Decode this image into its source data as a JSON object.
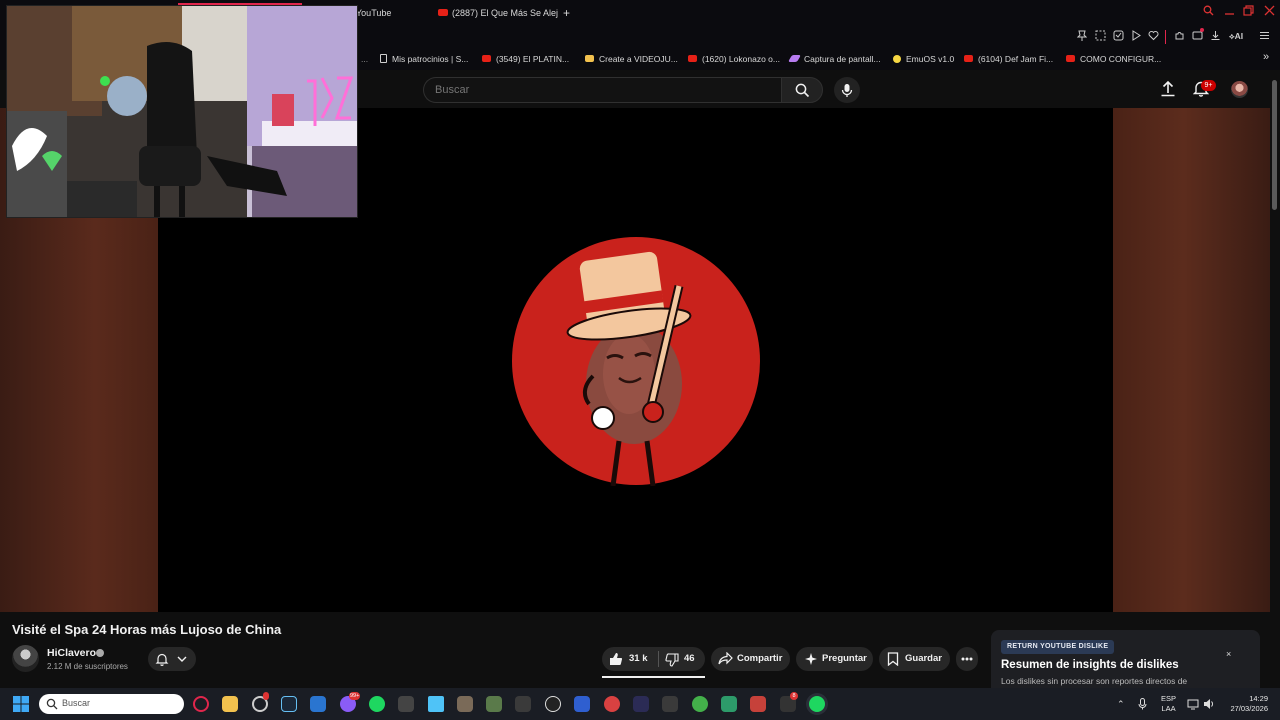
{
  "browser": {
    "tabs": [
      {
        "label": "YouTube",
        "favicon": "youtube-icon"
      },
      {
        "label": "(2887) El Que Más Se Alej",
        "favicon": "youtube-icon"
      }
    ],
    "new_tab": "+",
    "accent_color": "#e0264c"
  },
  "bookmarks": [
    {
      "label": "Mis patrocinios | S...",
      "icon": "page-icon",
      "color": "#cfcfcf"
    },
    {
      "label": "(3549) El PLATIN...",
      "icon": "youtube-icon",
      "color": "#e62117"
    },
    {
      "label": "Create a VIDEOJU...",
      "icon": "folder-icon",
      "color": "#f2c14e"
    },
    {
      "label": "(1620) Lokonazo o...",
      "icon": "youtube-icon",
      "color": "#e62117"
    },
    {
      "label": "Captura de pantall...",
      "icon": "feather-icon",
      "color": "#b77cf0"
    },
    {
      "label": "EmuOS v1.0",
      "icon": "emuos-icon",
      "color": "#f6d743"
    },
    {
      "label": "(6104) Def Jam Fi...",
      "icon": "youtube-icon",
      "color": "#e62117"
    },
    {
      "label": "COMO CONFIGUR...",
      "icon": "youtube-icon",
      "color": "#e62117"
    }
  ],
  "youtube": {
    "search_placeholder": "Buscar",
    "notifications_badge": "9+"
  },
  "video": {
    "title": "Visité el Spa 24 Horas más Lujoso de China",
    "channel": "HiClavero",
    "subscribers": "2.12 M de suscriptores",
    "likes": "31 k",
    "dislikes": "46",
    "share": "Compartir",
    "ask": "Preguntar",
    "save": "Guardar"
  },
  "ryd": {
    "tag": "RETURN YOUTUBE DISLIKE",
    "heading": "Resumen de insights de dislikes",
    "body": "Los dislikes sin procesar son reportes directos de",
    "close": "×"
  },
  "taskbar": {
    "search_placeholder": "Buscar",
    "lang_line1": "ESP",
    "lang_line2": "LAA",
    "time": "14:29",
    "date": "27/03/2026",
    "badges": {
      "discord": "99+",
      "notif": "8"
    }
  }
}
